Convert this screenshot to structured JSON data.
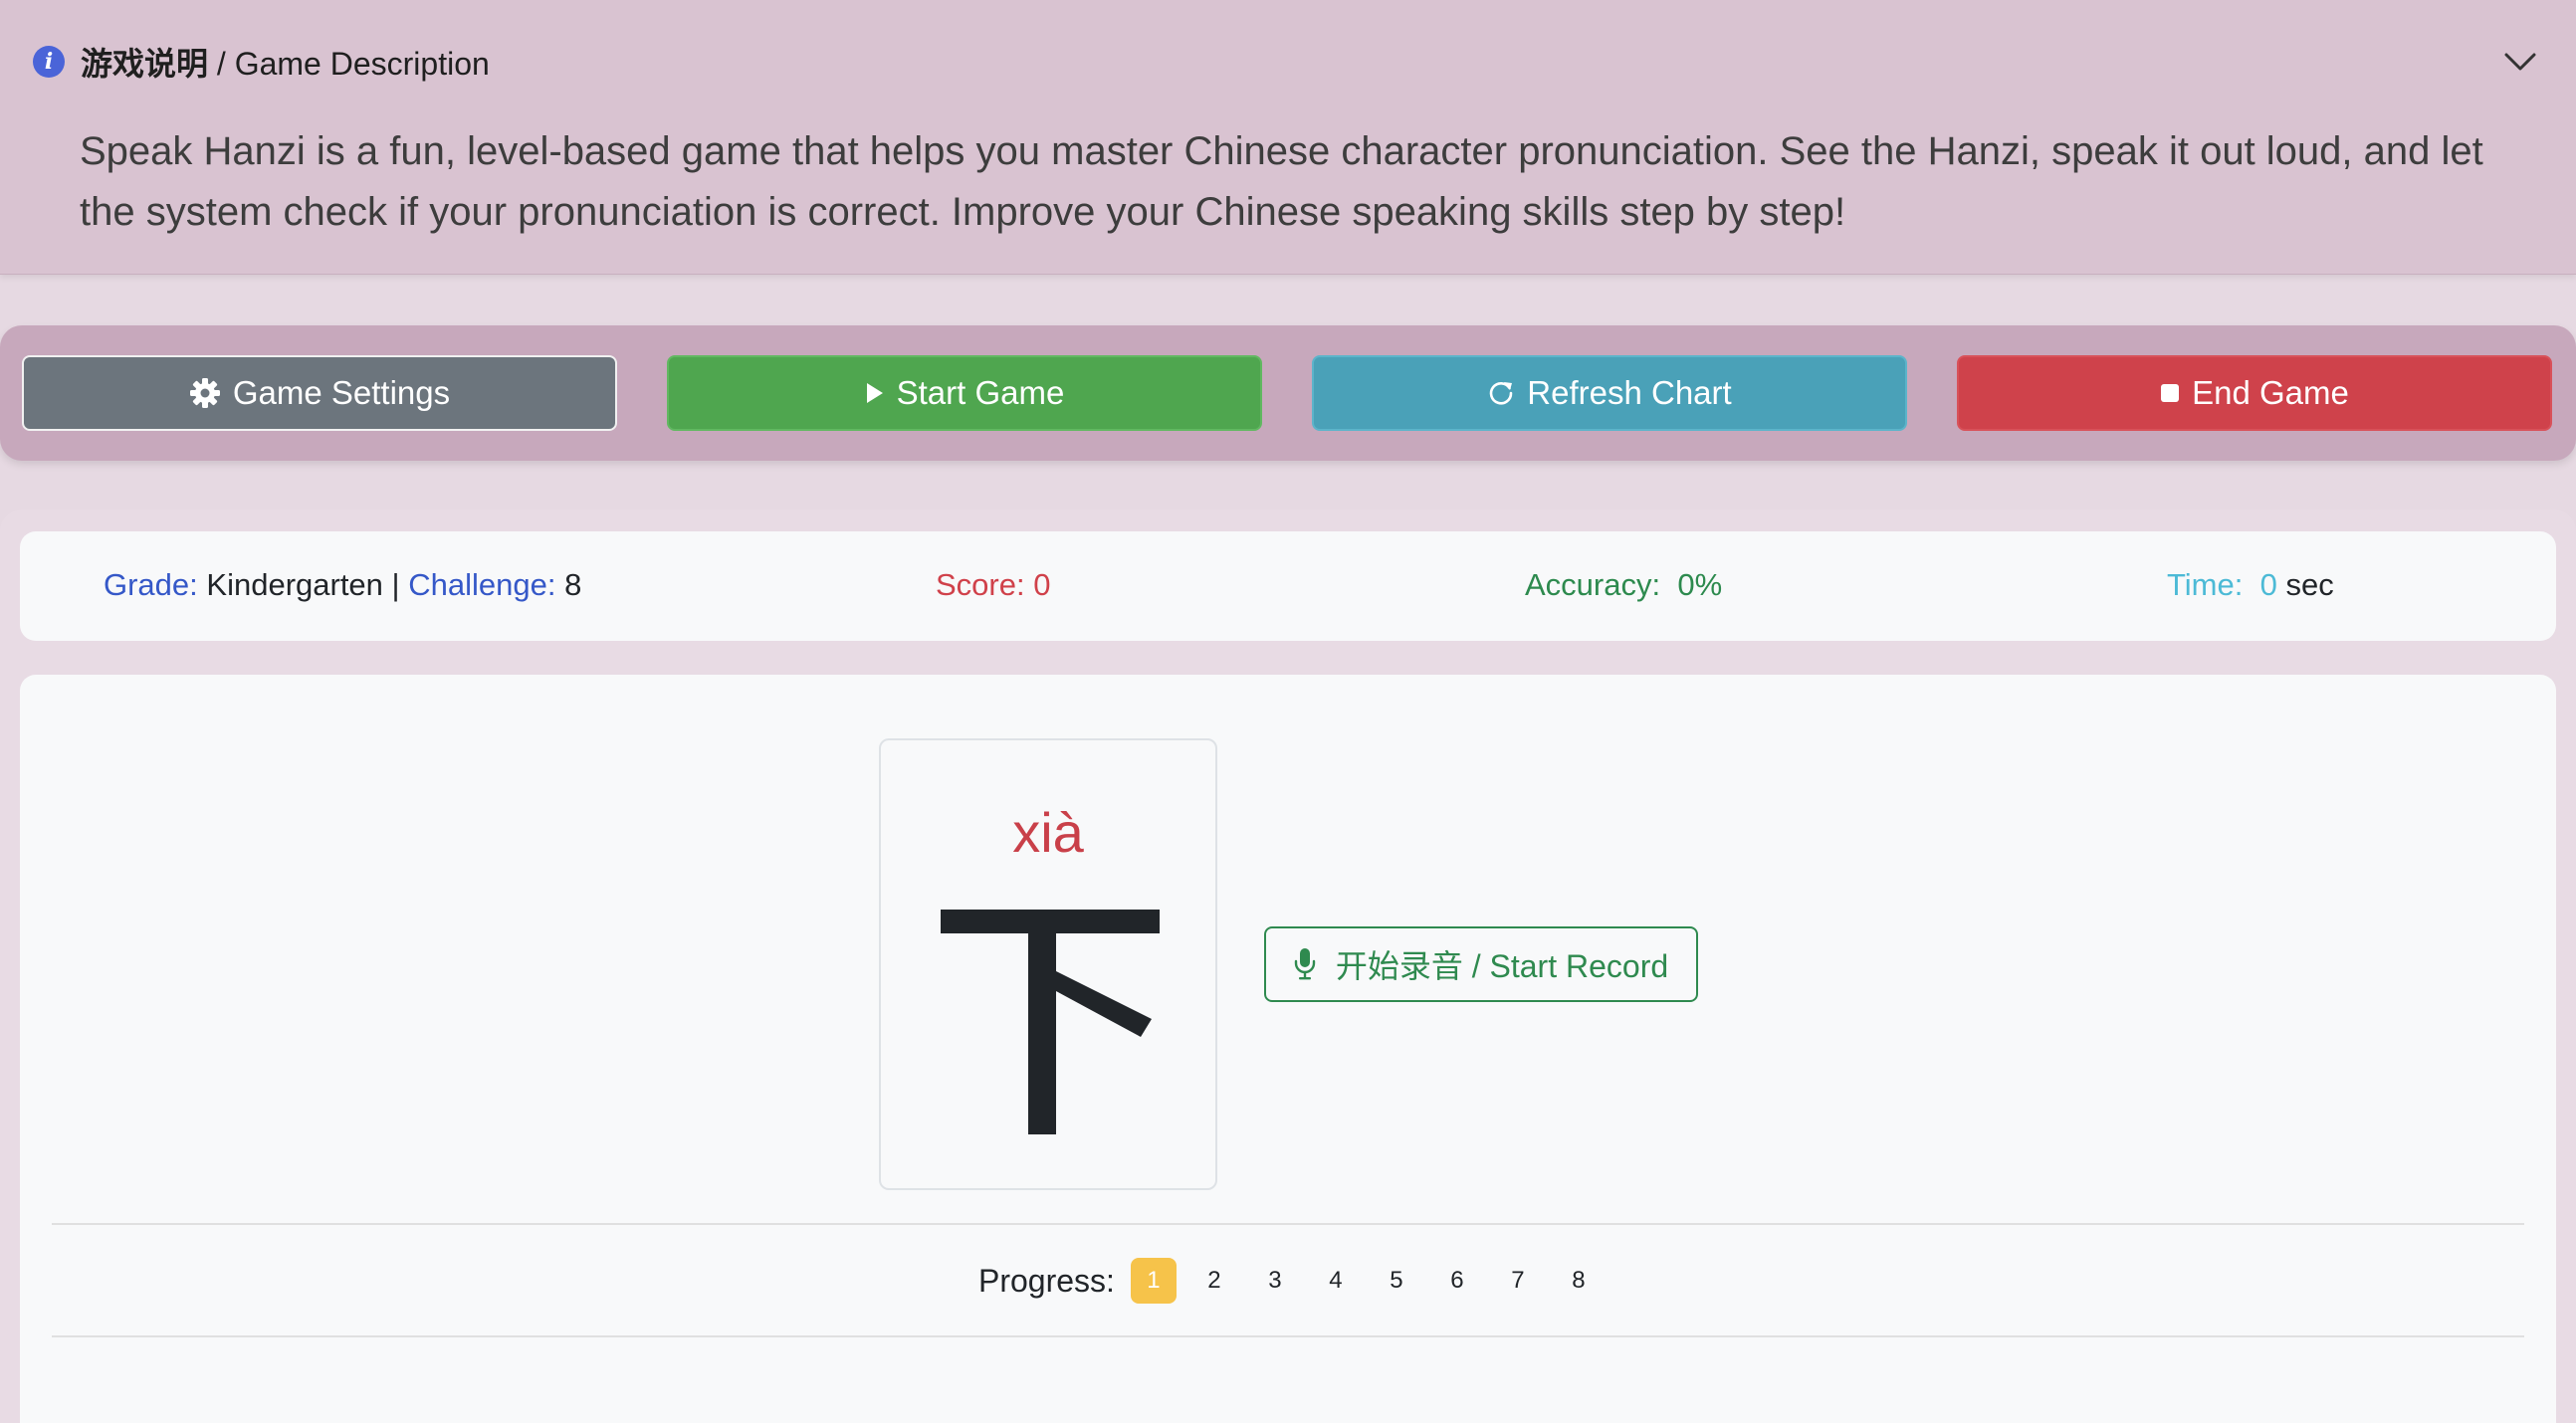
{
  "description": {
    "title_cn": "游戏说明",
    "title_sep": " / ",
    "title_en": "Game Description",
    "text": "Speak Hanzi is a fun, level-based game that helps you master Chinese character pronunciation. See the Hanzi, speak it out loud, and let the system check if your pronunciation is correct. Improve your Chinese speaking skills step by step!",
    "icon": "info-icon",
    "toggle_icon": "chevron-down-icon"
  },
  "toolbar": {
    "settings_label": "Game Settings",
    "start_label": "Start Game",
    "refresh_label": "Refresh Chart",
    "end_label": "End Game",
    "colors": {
      "settings": "#6c757d",
      "start": "#4fa64f",
      "refresh": "#4aa1b8",
      "end": "#cf424b"
    }
  },
  "stats": {
    "grade_label": "Grade:",
    "grade_value": "Kindergarten",
    "separator": "|",
    "challenge_label": "Challenge:",
    "challenge_value": "8",
    "score_label": "Score:",
    "score_value": "0",
    "accuracy_label": "Accuracy:",
    "accuracy_value": "0%",
    "time_label": "Time:",
    "time_value": "0",
    "time_unit": "sec"
  },
  "card": {
    "pinyin": "xià",
    "hanzi": "下"
  },
  "record": {
    "label": "开始录音 / Start Record",
    "icon": "microphone-icon"
  },
  "progress": {
    "label": "Progress:",
    "steps": [
      "1",
      "2",
      "3",
      "4",
      "5",
      "6",
      "7",
      "8"
    ],
    "current": 1,
    "active_color": "#f6c34a"
  }
}
